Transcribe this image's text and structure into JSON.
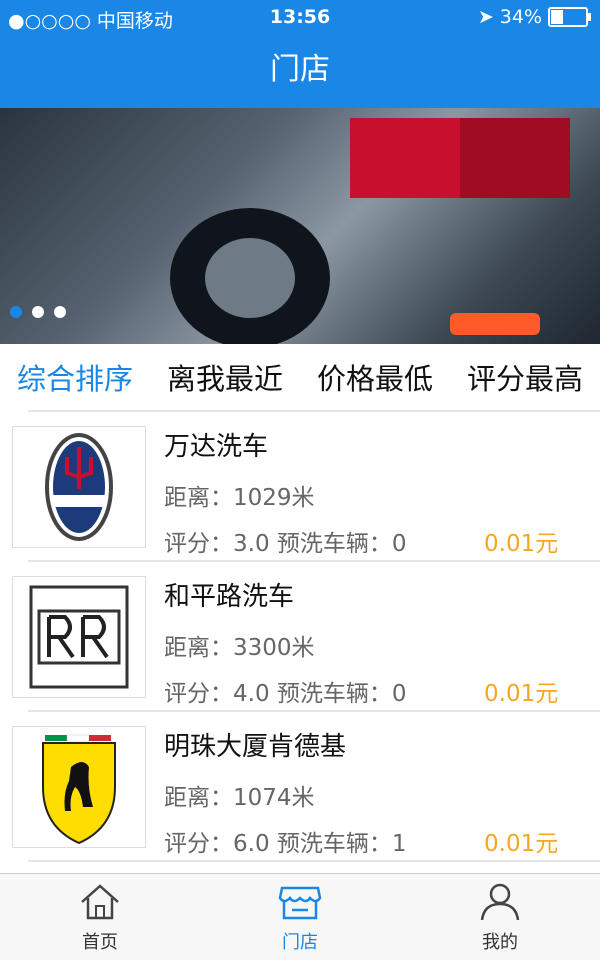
{
  "status": {
    "carrier": "●○○○○ 中国移动",
    "time": "13:56",
    "battery": "34%",
    "battery_level": 0.34
  },
  "nav": {
    "title": "门店"
  },
  "banner": {
    "dots": 3,
    "active": 0
  },
  "sort": {
    "tabs": [
      "综合排序",
      "离我最近",
      "价格最低",
      "评分最高"
    ],
    "active": 0
  },
  "stores": [
    {
      "name": "万达洗车",
      "distance": "距离：1029米",
      "meta": "评分：3.0  预洗车辆：0",
      "price": "0.01元",
      "logo": "maserati-logo"
    },
    {
      "name": "和平路洗车",
      "distance": "距离：3300米",
      "meta": "评分：4.0  预洗车辆：0",
      "price": "0.01元",
      "logo": "rolls-royce-logo"
    },
    {
      "name": "明珠大厦肯德基",
      "distance": "距离：1074米",
      "meta": "评分：6.0  预洗车辆：1",
      "price": "0.01元",
      "logo": "ferrari-logo"
    }
  ],
  "tabbar": {
    "items": [
      {
        "label": "首页",
        "icon": "home-icon"
      },
      {
        "label": "门店",
        "icon": "store-icon"
      },
      {
        "label": "我的",
        "icon": "user-icon"
      }
    ],
    "active": 1
  },
  "colors": {
    "primary": "#1a87e6",
    "price": "#f5a623"
  }
}
